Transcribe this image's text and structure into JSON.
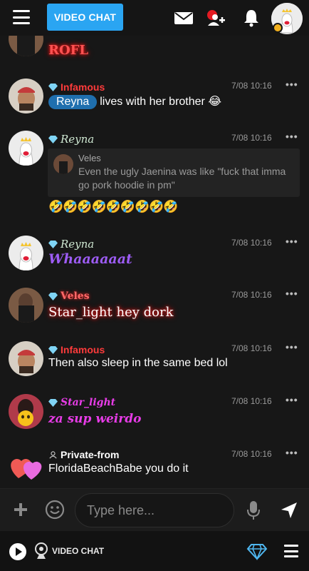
{
  "topbar": {
    "video_chat_label": "VIDEO CHAT",
    "icons": [
      "menu-icon",
      "mail-icon",
      "user-add-icon",
      "bell-icon",
      "avatar"
    ]
  },
  "messages": [
    {
      "text": "ROFL"
    },
    {
      "name": "Infamous",
      "time": "7/08 10:16",
      "mention": "Reyna",
      "text": "lives with her brother 😂"
    },
    {
      "name": "Reyna",
      "time": "7/08 10:16",
      "quote": {
        "name": "Veles",
        "text": "Even the ugly Jaenina was like \"fuck that imma go pork hoodie in pm\""
      },
      "emojis": "🤣🤣🤣🤣🤣🤣🤣🤣🤣"
    },
    {
      "name": "Reyna",
      "time": "7/08 10:16",
      "text": "Whaaaaaat"
    },
    {
      "name": "Veles",
      "time": "7/08 10:16",
      "text": "Star_light hey dork"
    },
    {
      "name": "Infamous",
      "time": "7/08 10:16",
      "text": "Then also sleep in the same bed lol"
    },
    {
      "name": "Star_light",
      "time": "7/08 10:16",
      "text": "za sup weirdo"
    },
    {
      "name": "Private-from",
      "time": "7/08 10:16",
      "text": "FloridaBeachBabe you do it"
    }
  ],
  "more_label": "•••",
  "input": {
    "placeholder": "Type here..."
  },
  "bottombar": {
    "video_chat_label": "VIDEO CHAT"
  },
  "colors": {
    "accent": "#2aa5f2",
    "background": "#171717",
    "mention": "#1f6fae",
    "infamous": "#ff3b3b",
    "star_light": "#e83ce8",
    "reyna_text": "#9d5cf5"
  }
}
